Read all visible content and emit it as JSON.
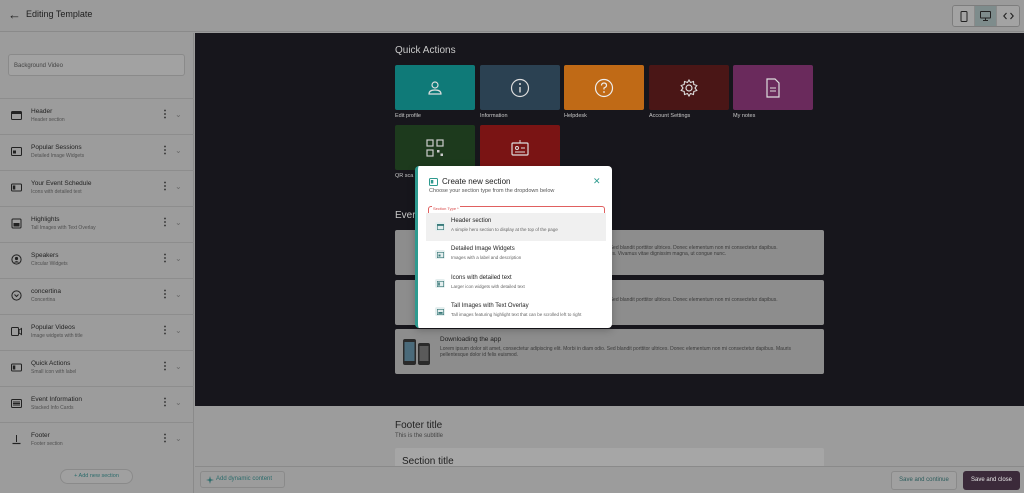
{
  "topbar": {
    "title": "Editing Template"
  },
  "sidebar": {
    "background_video": "Background Video",
    "items": [
      {
        "name": "Header",
        "sub": "Header section",
        "icon": "header-icon"
      },
      {
        "name": "Popular Sessions",
        "sub": "Detailed Image Widgets",
        "icon": "image-widget-icon"
      },
      {
        "name": "Your Event Schedule",
        "sub": "Icons with detailed text",
        "icon": "icon-text-icon"
      },
      {
        "name": "Highlights",
        "sub": "Tall Images with Text Overlay",
        "icon": "image-icon"
      },
      {
        "name": "Speakers",
        "sub": "Circular Widgets",
        "icon": "person-circle-icon"
      },
      {
        "name": "concertina",
        "sub": "Concertina",
        "icon": "chevron-circle-icon"
      },
      {
        "name": "Popular Videos",
        "sub": "Image widgets with title",
        "icon": "video-icon"
      },
      {
        "name": "Quick Actions",
        "sub": "Small icon with label",
        "icon": "icon-text-icon"
      },
      {
        "name": "Event Information",
        "sub": "Stacked Info Cards",
        "icon": "stacked-cards-icon"
      },
      {
        "name": "Footer",
        "sub": "Footer section",
        "icon": "footer-icon"
      }
    ],
    "add_section": "+ Add new section"
  },
  "canvas": {
    "quick_actions_title": "Quick Actions",
    "tiles": [
      {
        "label": "Edit profile",
        "color": "#0f7a78",
        "icon": "person-icon"
      },
      {
        "label": "Information",
        "color": "#2b4152",
        "icon": "info-icon"
      },
      {
        "label": "Helpdesk",
        "color": "#c06a16",
        "icon": "question-icon"
      },
      {
        "label": "Account Settings",
        "color": "#4a1616",
        "icon": "gear-icon"
      },
      {
        "label": "My notes",
        "color": "#6a2a5c",
        "icon": "document-icon"
      },
      {
        "label": "QR sca",
        "color": "#1d3a1d",
        "icon": "qr-icon"
      },
      {
        "label": "",
        "color": "#7a1414",
        "icon": "badge-icon"
      }
    ],
    "events_title": "Ever",
    "card_text": "...Sed blandit porttitor ultrices. Donec elementum non mi consectetur dapibus. Sed blandit porttitor ultrices.",
    "card1_text_a": "...sse. Sed blandit porttitor ultrices. Donec elementum non mi consectetur dapibus.",
    "card1_text_b": "...ultrices. Vivamus vitae dignissim magna, ut congue nunc.",
    "card2_text": "...sse. Sed blandit porttitor ultrices. Donec elementum non mi consectetur dapibus.",
    "card3": {
      "title": "Downloading the app",
      "body": "Lorem ipsum dolor sit amet, consectetur adipiscing elit. Morbi in diam odio. Sed blandit porttitor ultrices. Donec elementum non mi consectetur dapibus. Mauris pellentesque dolor id felis euismod."
    },
    "footer_title": "Footer title",
    "footer_subtitle": "This is the subtitle",
    "section_title": "Section title"
  },
  "bottombar": {
    "dynamic_content": "Add dynamic content",
    "save_continue": "Save and continue",
    "save_close": "Save and close"
  },
  "modal": {
    "title": "Create new section",
    "subtitle": "Choose your section type from the dropdown below",
    "select_label": "Section Type *",
    "options": [
      {
        "name": "Header section",
        "desc": "A simple hero section to display at the top of the page"
      },
      {
        "name": "Detailed Image Widgets",
        "desc": "Images with a label and description"
      },
      {
        "name": "Icons with detailed text",
        "desc": "Larger icon widgets with detailed text"
      },
      {
        "name": "Tall Images with Text Overlay",
        "desc": "Tall images featuring highlight text that can be scrolled left to right"
      }
    ]
  },
  "colors": {
    "accent": "#2e9a8f",
    "dark_canvas": "#17161c",
    "save_close_bg": "#3b2a3a",
    "error": "#d84848"
  }
}
